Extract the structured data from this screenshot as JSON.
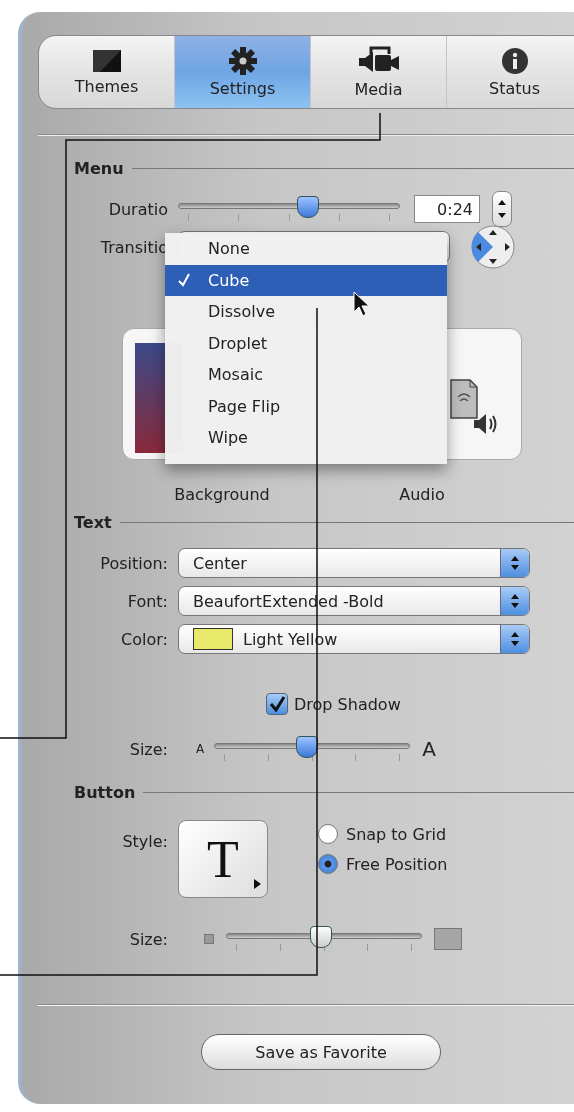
{
  "tabs": [
    {
      "label": "Themes",
      "selected": false
    },
    {
      "label": "Settings",
      "selected": true
    },
    {
      "label": "Media",
      "selected": false
    },
    {
      "label": "Status",
      "selected": false
    }
  ],
  "menu": {
    "heading": "Menu",
    "duration": {
      "label": "Duratio",
      "level": 0.58,
      "value": "0:24"
    },
    "transition": {
      "label": "Transitio"
    },
    "transition_options": [
      {
        "label": "None",
        "selected": false
      },
      {
        "label": "Cube",
        "selected": true
      },
      {
        "label": "Dissolve",
        "selected": false
      },
      {
        "label": "Droplet",
        "selected": false
      },
      {
        "label": "Mosaic",
        "selected": false
      },
      {
        "label": "Page Flip",
        "selected": false
      },
      {
        "label": "Wipe",
        "selected": false
      }
    ],
    "wells": [
      {
        "label": "Background"
      },
      {
        "label": "Audio"
      }
    ]
  },
  "text": {
    "heading": "Text",
    "popups": [
      {
        "label": "Position:",
        "value": "Center"
      },
      {
        "label": "Font:",
        "value": "BeaufortExtended -Bold"
      },
      {
        "label": "Color:",
        "value": "Light Yellow",
        "color": "#e8e86a"
      }
    ],
    "drop_shadow": {
      "label": "Drop Shadow",
      "checked": true
    },
    "size": {
      "label": "Size:",
      "small": "A",
      "large": "A",
      "level": 0.47
    }
  },
  "button": {
    "heading": "Button",
    "style": {
      "label": "Style:",
      "glyph": "T"
    },
    "placement": [
      {
        "label": "Snap to Grid",
        "selected": false
      },
      {
        "label": "Free Position",
        "selected": true
      }
    ],
    "size": {
      "label": "Size:",
      "level": 0.48
    }
  },
  "save_button": "Save as Favorite"
}
